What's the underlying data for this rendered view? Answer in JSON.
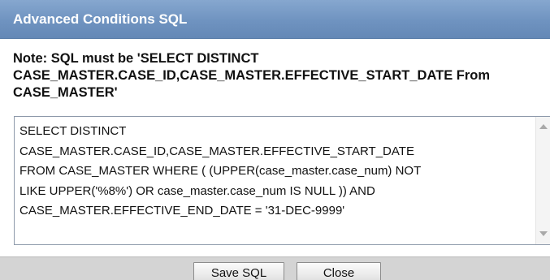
{
  "dialog": {
    "title": "Advanced Conditions SQL",
    "note": "Note: SQL must be 'SELECT DISTINCT\nCASE_MASTER.CASE_ID,CASE_MASTER.EFFECTIVE_START_DATE From\nCASE_MASTER'",
    "sql_text": "SELECT DISTINCT\nCASE_MASTER.CASE_ID,CASE_MASTER.EFFECTIVE_START_DATE\nFROM CASE_MASTER WHERE  ( (UPPER(case_master.case_num) NOT\nLIKE UPPER('%8%') OR case_master.case_num IS NULL )) AND\nCASE_MASTER.EFFECTIVE_END_DATE = '31-DEC-9999'",
    "buttons": {
      "save_label": "Save SQL",
      "close_label": "Close"
    },
    "icons": {
      "scroll_up": "scroll-up-arrow-icon",
      "scroll_down": "scroll-down-arrow-icon"
    },
    "colors": {
      "titlebar": "#6f93c0",
      "title_text": "#ffffff",
      "button_bar": "#d4d4d4",
      "box_border": "#8e9aab"
    }
  }
}
